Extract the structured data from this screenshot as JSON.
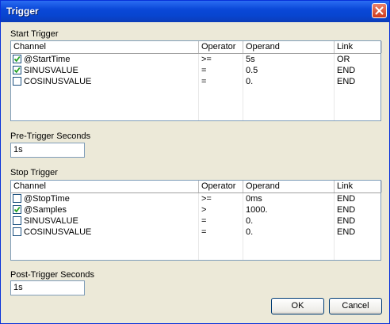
{
  "window": {
    "title": "Trigger"
  },
  "columns": {
    "channel": "Channel",
    "operator": "Operator",
    "operand": "Operand",
    "link": "Link"
  },
  "start_trigger": {
    "label": "Start Trigger",
    "rows": [
      {
        "checked": true,
        "channel": "@StartTime",
        "operator": ">=",
        "operand": "5s",
        "link": "OR"
      },
      {
        "checked": true,
        "channel": "SINUSVALUE",
        "operator": "=",
        "operand": "0.5",
        "link": "END"
      },
      {
        "checked": false,
        "channel": "COSINUSVALUE",
        "operator": "=",
        "operand": "0.",
        "link": "END"
      }
    ]
  },
  "pre_trigger": {
    "label": "Pre-Trigger Seconds",
    "value": "1s"
  },
  "stop_trigger": {
    "label": "Stop Trigger",
    "rows": [
      {
        "checked": false,
        "channel": "@StopTime",
        "operator": ">=",
        "operand": "0ms",
        "link": "END"
      },
      {
        "checked": true,
        "channel": "@Samples",
        "operator": ">",
        "operand": "1000.",
        "link": "END"
      },
      {
        "checked": false,
        "channel": "SINUSVALUE",
        "operator": "=",
        "operand": "0.",
        "link": "END"
      },
      {
        "checked": false,
        "channel": "COSINUSVALUE",
        "operator": "=",
        "operand": "0.",
        "link": "END"
      }
    ]
  },
  "post_trigger": {
    "label": "Post-Trigger Seconds",
    "value": "1s"
  },
  "buttons": {
    "ok": "OK",
    "cancel": "Cancel"
  }
}
